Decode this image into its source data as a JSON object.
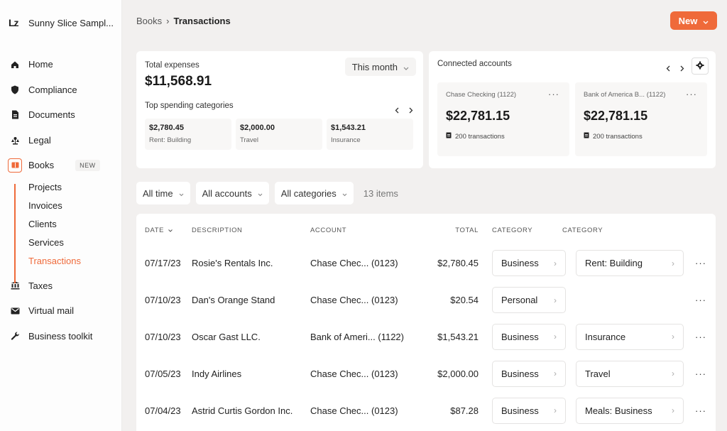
{
  "org": {
    "logo": "Lz",
    "name": "Sunny Slice Sampl..."
  },
  "nav": {
    "home": "Home",
    "compliance": "Compliance",
    "documents": "Documents",
    "legal": "Legal",
    "books": "Books",
    "books_badge": "NEW",
    "books_sub": [
      "Projects",
      "Invoices",
      "Clients",
      "Services",
      "Transactions"
    ],
    "taxes": "Taxes",
    "virtual_mail": "Virtual mail",
    "business_toolkit": "Business toolkit"
  },
  "breadcrumb": {
    "parent": "Books",
    "sep": "›",
    "current": "Transactions"
  },
  "new_button": {
    "label": "New",
    "chevron": "⌄"
  },
  "expenses": {
    "label": "Total expenses",
    "amount": "$11,568.91",
    "period": "This month",
    "top_label": "Top spending categories",
    "items": [
      {
        "amount": "$2,780.45",
        "label": "Rent: Building"
      },
      {
        "amount": "$2,000.00",
        "label": "Travel"
      },
      {
        "amount": "$1,543.21",
        "label": "Insurance"
      }
    ]
  },
  "connected": {
    "label": "Connected accounts",
    "accounts": [
      {
        "name": "Chase Checking (1122)",
        "balance": "$22,781.15",
        "tx": "200 transactions"
      },
      {
        "name": "Bank of America B... (1122)",
        "balance": "$22,781.15",
        "tx": "200 transactions"
      }
    ]
  },
  "filters": {
    "time": "All time",
    "accounts": "All accounts",
    "categories": "All categories",
    "count": "13 items"
  },
  "table": {
    "headers": {
      "date": "DATE",
      "description": "DESCRIPTION",
      "account": "ACCOUNT",
      "total": "TOTAL",
      "category1": "CATEGORY",
      "category2": "CATEGORY"
    },
    "rows": [
      {
        "date": "07/17/23",
        "description": "Rosie's Rentals Inc.",
        "account": "Chase Chec... (0123)",
        "total": "$2,780.45",
        "cat1": "Business",
        "cat2": "Rent: Building"
      },
      {
        "date": "07/10/23",
        "description": "Dan's Orange Stand",
        "account": "Chase Chec... (0123)",
        "total": "$20.54",
        "cat1": "Personal",
        "cat2": ""
      },
      {
        "date": "07/10/23",
        "description": "Oscar Gast LLC.",
        "account": "Bank of Ameri... (1122)",
        "total": "$1,543.21",
        "cat1": "Business",
        "cat2": "Insurance"
      },
      {
        "date": "07/05/23",
        "description": "Indy Airlines",
        "account": "Chase Chec... (0123)",
        "total": "$2,000.00",
        "cat1": "Business",
        "cat2": "Travel"
      },
      {
        "date": "07/04/23",
        "description": "Astrid Curtis Gordon Inc.",
        "account": "Chase Chec... (0123)",
        "total": "$87.28",
        "cat1": "Business",
        "cat2": "Meals: Business"
      }
    ]
  },
  "colors": {
    "accent": "#ef6a3a",
    "background": "#f2f0ef",
    "card": "#ffffff"
  },
  "icons": [
    "home-icon",
    "shield-icon",
    "document-icon",
    "legal-icon",
    "books-icon",
    "taxes-icon",
    "mail-icon",
    "wrench-icon",
    "gear-icon",
    "chevron-left-icon",
    "chevron-right-icon",
    "more-icon",
    "bank-icon"
  ]
}
